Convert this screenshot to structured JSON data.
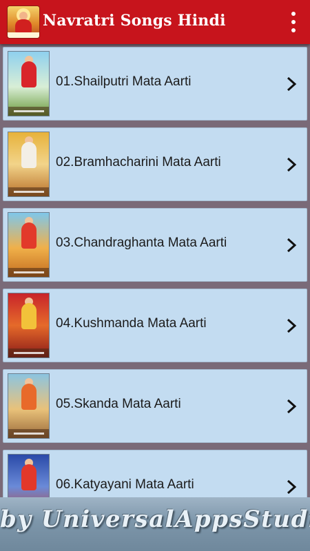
{
  "app": {
    "title": "Navratri Songs Hindi",
    "icon": "goddess-logo-icon",
    "menu_icon": "more-vertical-icon"
  },
  "colors": {
    "app_bar": "#c7141c",
    "row_background": "#c3dcf1",
    "background": "#7a6a78"
  },
  "list": {
    "items": [
      {
        "label": "01.Shailputri Mata Aarti",
        "thumbnail": "shailputri-thumbnail"
      },
      {
        "label": "02.Bramhacharini Mata Aarti",
        "thumbnail": "bramhacharini-thumbnail"
      },
      {
        "label": "03.Chandraghanta Mata Aarti",
        "thumbnail": "chandraghanta-thumbnail"
      },
      {
        "label": "04.Kushmanda Mata Aarti",
        "thumbnail": "kushmanda-thumbnail"
      },
      {
        "label": "05.Skanda Mata Aarti",
        "thumbnail": "skanda-thumbnail"
      },
      {
        "label": "06.Katyayani Mata Aarti",
        "thumbnail": "katyayani-thumbnail"
      }
    ],
    "chevron_icon": "chevron-right-icon"
  },
  "banner": {
    "text": "by UniversalAppsStudio"
  }
}
